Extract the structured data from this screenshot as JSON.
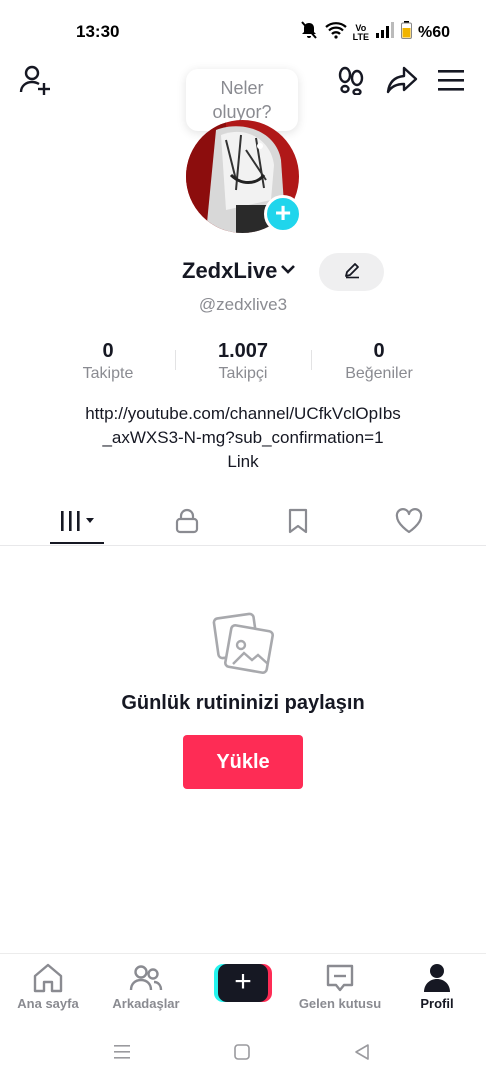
{
  "status_bar": {
    "time": "13:30",
    "battery": "%60",
    "network": "LTE"
  },
  "header": {
    "add_friend_icon": "person-add-icon",
    "footprints_icon": "footprints-icon",
    "share_icon": "share-icon",
    "menu_icon": "menu-icon"
  },
  "tooltip": {
    "line1": "Neler",
    "line2": "oluyor?"
  },
  "profile": {
    "username": "ZedxLive",
    "handle": "@zedxlive3",
    "stats": [
      {
        "value": "0",
        "label": "Takipte"
      },
      {
        "value": "1.007",
        "label": "Takipçi"
      },
      {
        "value": "0",
        "label": "Beğeniler"
      }
    ],
    "bio_line1": "http://youtube.com/channel/UCfkVclOpIbs",
    "bio_line2": "_axWXS3-N-mg?sub_confirmation=1",
    "bio_line3": "Link"
  },
  "tabs": [
    "videos-grid-icon",
    "lock-icon",
    "bookmark-icon",
    "heart-icon"
  ],
  "empty_state": {
    "title": "Günlük rutininizi paylaşın",
    "button": "Yükle"
  },
  "bottom_nav": [
    {
      "label": "Ana sayfa",
      "icon": "home-icon"
    },
    {
      "label": "Arkadaşlar",
      "icon": "friends-icon"
    },
    {
      "label": "",
      "icon": "create-icon"
    },
    {
      "label": "Gelen kutusu",
      "icon": "inbox-icon"
    },
    {
      "label": "Profil",
      "icon": "profile-icon"
    }
  ],
  "colors": {
    "accent": "#fe2c55",
    "cyan": "#25f4ee",
    "add_badge": "#20d5ec",
    "text": "#161823",
    "muted": "#8a8b91"
  }
}
